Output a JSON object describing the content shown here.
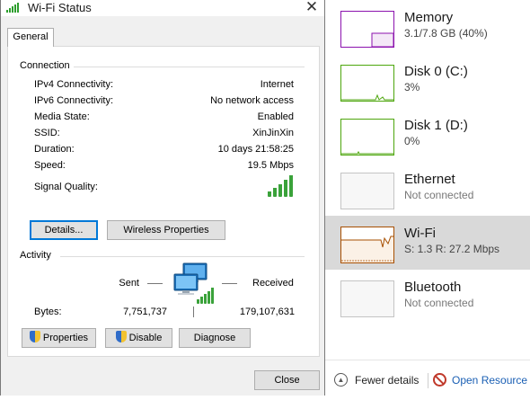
{
  "dialog": {
    "title": "Wi-Fi Status",
    "close_glyph": "✕",
    "tab": "General",
    "connection": {
      "heading": "Connection",
      "rows": [
        {
          "label": "IPv4 Connectivity:",
          "value": "Internet"
        },
        {
          "label": "IPv6 Connectivity:",
          "value": "No network access"
        },
        {
          "label": "Media State:",
          "value": "Enabled"
        },
        {
          "label": "SSID:",
          "value": "XinJinXin"
        },
        {
          "label": "Duration:",
          "value": "10 days 21:58:25"
        },
        {
          "label": "Speed:",
          "value": "19.5 Mbps"
        }
      ],
      "signal_label": "Signal Quality:",
      "signal_bars": 5,
      "details_button": "Details...",
      "wireless_button": "Wireless Properties"
    },
    "activity": {
      "heading": "Activity",
      "sent_label": "Sent",
      "received_label": "Received",
      "bytes_label": "Bytes:",
      "bytes_sent": "7,751,737",
      "bytes_received": "179,107,631"
    },
    "buttons": {
      "properties": "Properties",
      "disable": "Disable",
      "diagnose": "Diagnose",
      "close": "Close"
    }
  },
  "task_manager": {
    "items": [
      {
        "title": "Memory",
        "subtitle": "3.1/7.8 GB (40%)",
        "color": "#8b12ae"
      },
      {
        "title": "Disk 0 (C:)",
        "subtitle": "3%",
        "color": "#4da60c"
      },
      {
        "title": "Disk 1 (D:)",
        "subtitle": "0%",
        "color": "#4da60c"
      },
      {
        "title": "Ethernet",
        "subtitle": "Not connected",
        "color": "#c4c4c4"
      },
      {
        "title": "Wi-Fi",
        "subtitle": "S: 1.3  R: 27.2 Mbps",
        "color": "#a74f01",
        "selected": true
      },
      {
        "title": "Bluetooth",
        "subtitle": "Not connected",
        "color": "#c4c4c4"
      }
    ],
    "footer": {
      "fewer_details": "Fewer details",
      "open_resource": "Open Resource M"
    }
  }
}
